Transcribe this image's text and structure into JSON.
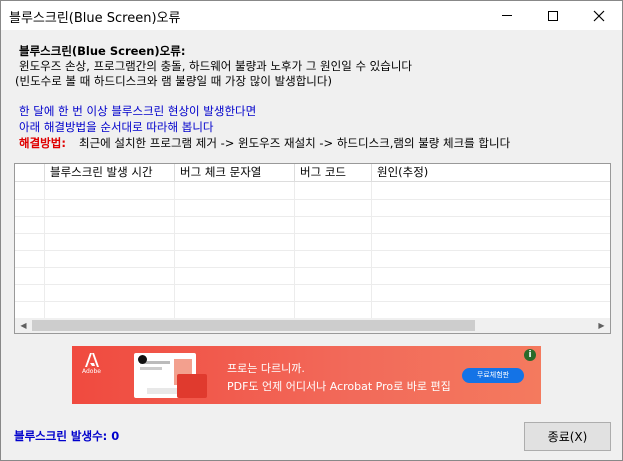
{
  "window": {
    "title": "블루스크린(Blue Screen)오류"
  },
  "info": {
    "heading": "블루스크린(Blue Screen)오류:",
    "line1": "윈도우즈 손상, 프로그램간의 충돌, 하드웨어 불량과 노후가 그 원인일 수 있습니다",
    "line2": "(빈도수로 볼 때 하드디스크와 램 불량일 때 가장 많이 발생합니다)",
    "blue1": "한 달에 한 번 이상 블루스크린 현상이 발생한다면",
    "blue2": "아래 해결방법을 순서대로 따라해 봅니다",
    "solution_label": "해결방법:",
    "solution_text": "최근에 설치한 프로그램 제거 -> 윈도우즈 재설치 -> 하드디스크,램의 불량 체크를 합니다"
  },
  "table": {
    "columns": [
      "",
      "블루스크린 발생 시간",
      "버그 체크 문자열",
      "버그 코드",
      "원인(추정)"
    ],
    "rows": []
  },
  "ad": {
    "brand": "Adobe",
    "line1": "프로는 다르니까.",
    "line2": "PDF도 언제 어디서나 Acrobat Pro로 바로 편집",
    "button": "무료체험판",
    "info_icon": "i"
  },
  "footer": {
    "count_label": "블루스크린 발생수: 0",
    "close_label": "종료(X)"
  },
  "colors": {
    "blue_text": "#0000cc",
    "red_text": "#e00000",
    "ad_bg": "#f04a3f"
  }
}
